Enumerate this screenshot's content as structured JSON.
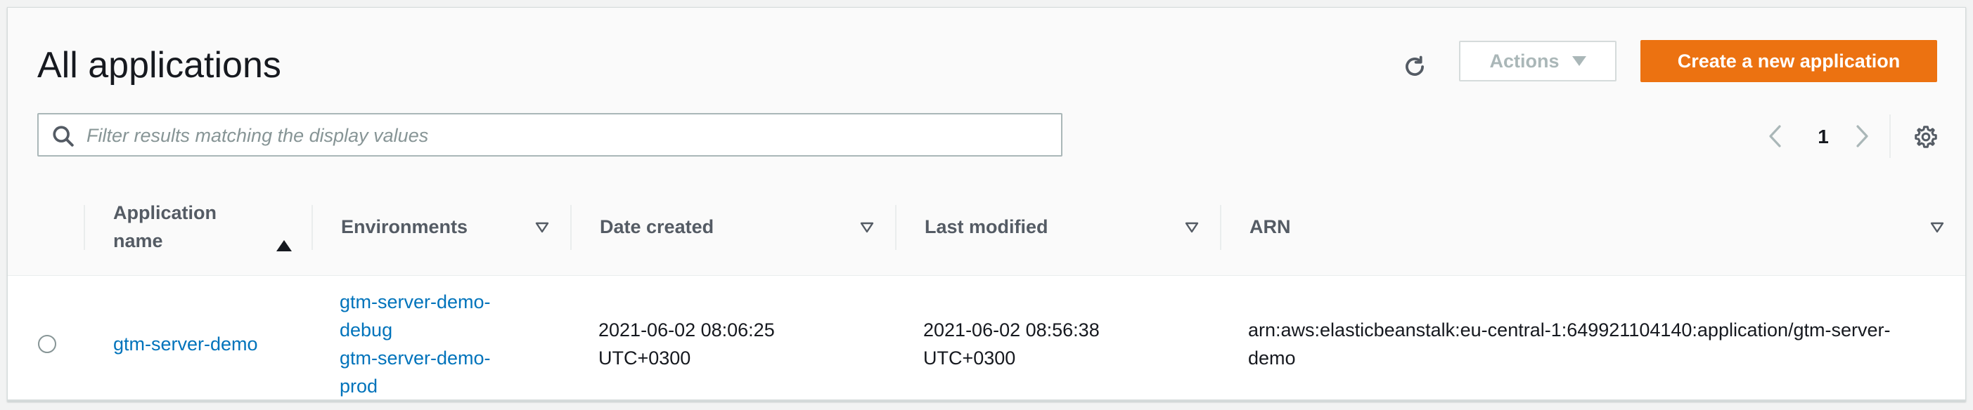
{
  "header": {
    "title": "All applications",
    "actions_label": "Actions",
    "create_label": "Create a new application"
  },
  "search": {
    "placeholder": "Filter results matching the display values",
    "value": ""
  },
  "pagination": {
    "current_page": "1"
  },
  "table": {
    "columns": [
      {
        "label": "Application name",
        "sort": "ascending"
      },
      {
        "label": "Environments"
      },
      {
        "label": "Date created"
      },
      {
        "label": "Last modified"
      },
      {
        "label": "ARN"
      }
    ],
    "rows": [
      {
        "selected": false,
        "application_name": "gtm-server-demo",
        "environments": [
          "gtm-server-demo-debug",
          "gtm-server-demo-prod"
        ],
        "date_created": "2021-06-02 08:06:25 UTC+0300",
        "last_modified": "2021-06-02 08:56:38 UTC+0300",
        "arn": "arn:aws:elasticbeanstalk:eu-central-1:649921104140:application/gtm-server-demo"
      }
    ]
  },
  "icons": {
    "refresh": "refresh-icon",
    "search": "search-icon",
    "prev": "chevron-left-icon",
    "next": "chevron-right-icon",
    "settings": "gear-icon"
  },
  "colors": {
    "primary_button": "#ec7211",
    "link": "#0073bb",
    "header_bg": "#fafafa",
    "page_bg": "#f2f3f3"
  }
}
